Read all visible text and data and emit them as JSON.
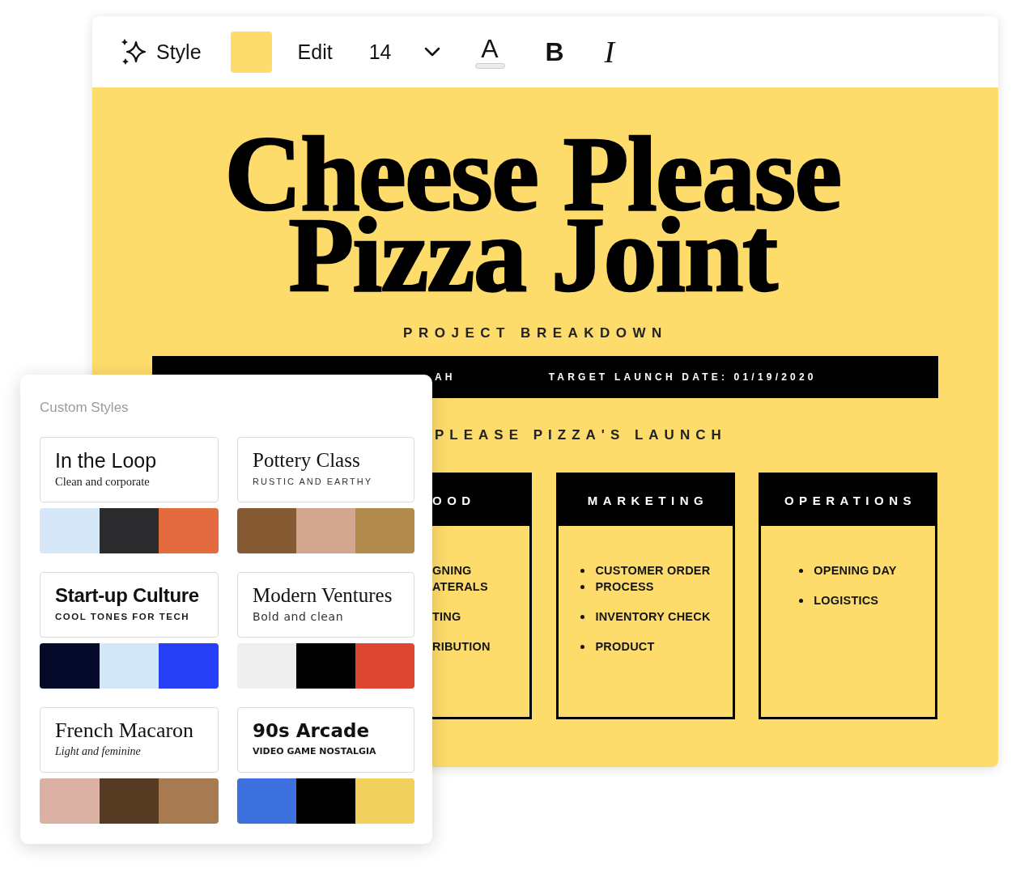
{
  "toolbar": {
    "style": {
      "label": "Style"
    },
    "fill_swatch": {
      "color": "#fddc6c"
    },
    "edit": {
      "label": "Edit"
    },
    "font_size": {
      "value": "14"
    },
    "text_color": {
      "glyph": "A"
    },
    "bold": {
      "glyph": "B"
    },
    "italic": {
      "glyph": "I"
    }
  },
  "document": {
    "title_lines": [
      "Cheese Please",
      "Pizza Joint"
    ],
    "subtitle": "PROJECT BREAKDOWN",
    "info_bar": [
      "AH",
      "TARGET LAUNCH DATE: 01/19/2020"
    ],
    "section_heading": "PLEASE PIZZA'S LAUNCH",
    "cards": [
      {
        "kind": "clipped",
        "heading": "OOD",
        "groups": [
          [
            "GNING",
            "ATERALS"
          ],
          [
            "TING"
          ],
          [
            "RIBUTION"
          ]
        ]
      },
      {
        "kind": "full",
        "heading": "MARKETING",
        "groups": [
          [
            "CUSTOMER ORDER",
            "PROCESS"
          ],
          [
            "INVENTORY CHECK"
          ],
          [
            "PRODUCT"
          ]
        ]
      },
      {
        "kind": "full",
        "heading": "OPERATIONS",
        "groups": [
          [
            "OPENING DAY"
          ],
          [
            "LOGISTICS"
          ]
        ]
      }
    ]
  },
  "style_panel": {
    "title": "Custom Styles",
    "styles": [
      {
        "name": "In the Loop",
        "tagline": "Clean and corporate",
        "palette": [
          {
            "color": "#d6e8f7"
          },
          {
            "color": "#2b2b2e"
          },
          {
            "color": "#e26b40"
          }
        ]
      },
      {
        "name": "Pottery Class",
        "tagline": "RUSTIC AND EARTHY",
        "palette": [
          {
            "color": "#855a33"
          },
          {
            "color": "#d3a690"
          },
          {
            "color": "#b38a4e"
          }
        ]
      },
      {
        "name": "Start-up Culture",
        "tagline": "COOL TONES FOR TECH",
        "palette": [
          {
            "color": "#050a2a"
          },
          {
            "color": "#d3e7f6"
          },
          {
            "color": "#2740f5"
          }
        ]
      },
      {
        "name": "Modern Ventures",
        "tagline": "Bold and clean",
        "palette": [
          {
            "color": "#efefef"
          },
          {
            "color": "#000000"
          },
          {
            "color": "#dd4631"
          }
        ]
      },
      {
        "name": "French Macaron",
        "tagline": "Light and feminine",
        "palette": [
          {
            "color": "#dbb1a3"
          },
          {
            "color": "#553b21"
          },
          {
            "color": "#a87a52"
          }
        ]
      },
      {
        "name": "90s Arcade",
        "tagline": "VIDEO GAME NOSTALGIA",
        "palette": [
          {
            "color": "#3d72de"
          },
          {
            "color": "#000000"
          },
          {
            "color": "#f1d05d"
          }
        ]
      }
    ]
  }
}
